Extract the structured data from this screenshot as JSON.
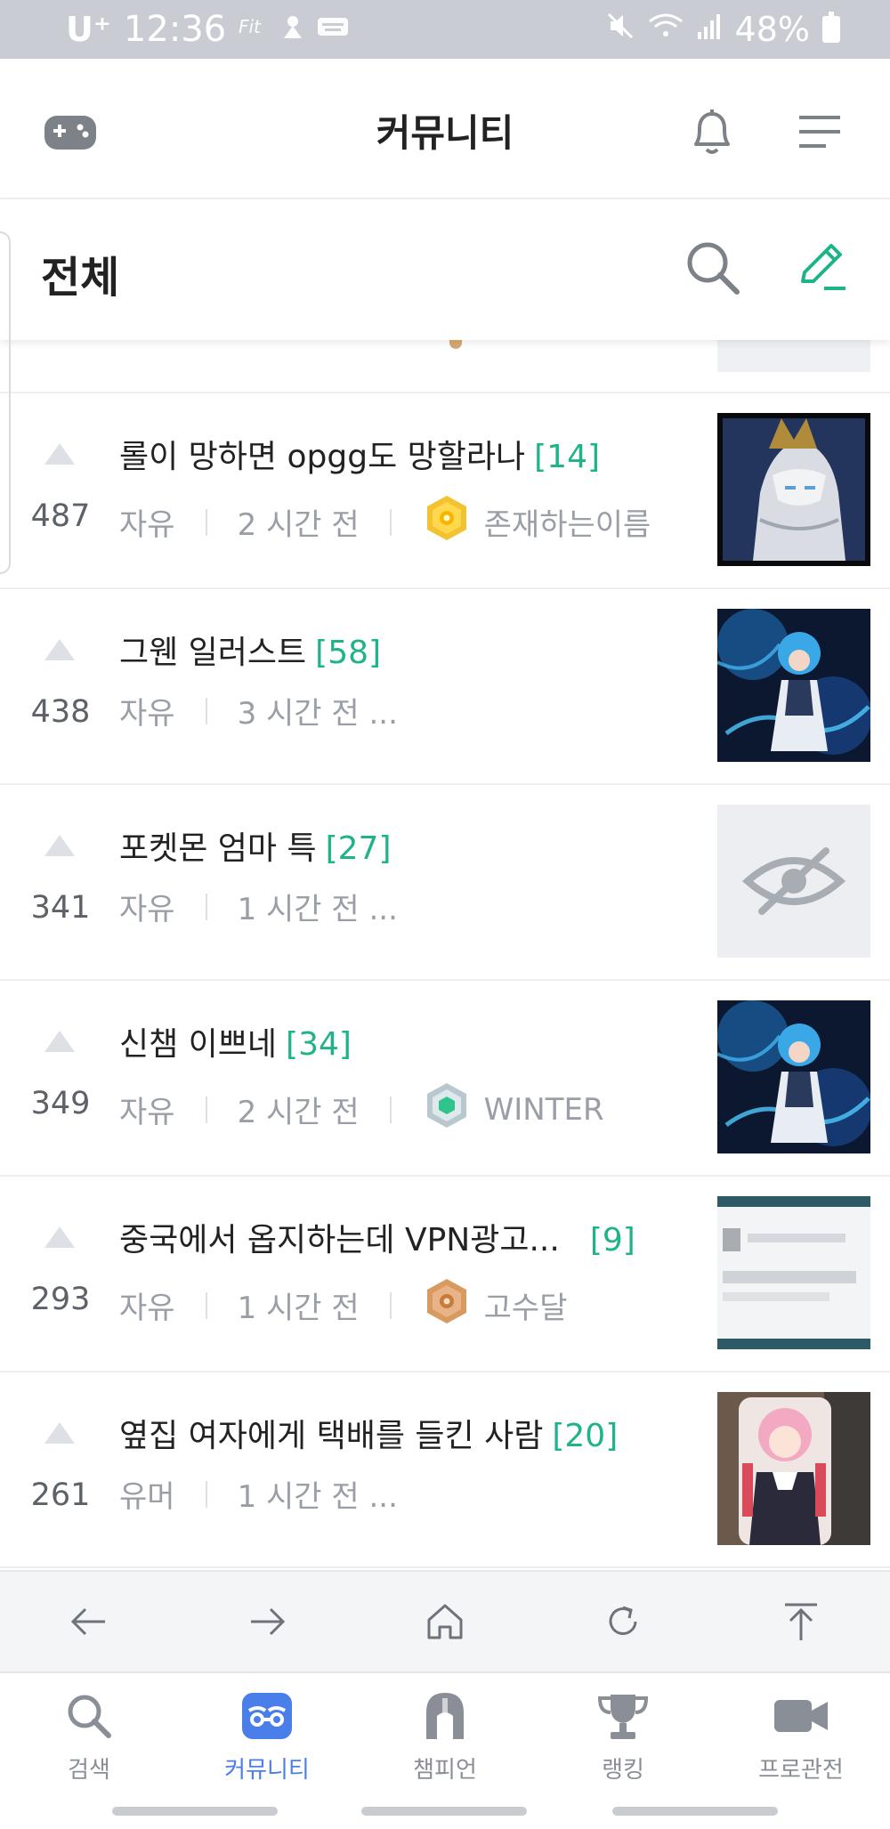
{
  "status_bar": {
    "carrier": "U⁺",
    "time": "12:36",
    "battery": "48%",
    "left_icons": [
      "fit-icon",
      "notification-icon",
      "keyboard-icon"
    ],
    "right_icons": [
      "mute-icon",
      "wifi-icon",
      "signal-icon",
      "battery-icon"
    ]
  },
  "header": {
    "title": "커뮤니티"
  },
  "section": {
    "title": "전체"
  },
  "colors": {
    "accent_green": "#1fb38a",
    "active_tab_blue": "#4a7ee8"
  },
  "posts": [
    {
      "title": "롤이 망하면 opgg도 망할라나",
      "comments": "[14]",
      "votes": "487",
      "category": "자유",
      "time": "2 시간 전",
      "author": "존재하는이름",
      "badge": "gold-hexagon-badge",
      "thumb": "armored-champion-thumbnail"
    },
    {
      "title": "그웬 일러스트",
      "comments": "[58]",
      "votes": "438",
      "category": "자유",
      "time": "3 시간 전 ...",
      "thumb": "gwen-illustration-thumbnail"
    },
    {
      "title": "포켓몬 엄마 특",
      "comments": "[27]",
      "votes": "341",
      "category": "자유",
      "time": "1 시간 전 ...",
      "thumb": "hidden-image-thumbnail"
    },
    {
      "title": "신챔 이쁘네",
      "comments": "[34]",
      "votes": "349",
      "category": "자유",
      "time": "2 시간 전",
      "author": "WINTER",
      "badge": "platinum-hexagon-badge",
      "thumb": "gwen-illustration-thumbnail"
    },
    {
      "title": "중국에서 옵지하는데 VPN광고...",
      "comments": "[9]",
      "votes": "293",
      "category": "자유",
      "time": "1 시간 전",
      "author": "고수달",
      "badge": "bronze-hexagon-badge",
      "thumb": "blurred-screenshot-thumbnail"
    },
    {
      "title": "옆집 여자에게 택배를 들킨 사람",
      "comments": "[20]",
      "votes": "261",
      "category": "유머",
      "time": "1 시간 전 ...",
      "thumb": "anime-pillow-thumbnail"
    }
  ],
  "browser_nav": [
    "back-icon",
    "forward-icon",
    "home-icon",
    "reload-icon",
    "scroll-top-icon"
  ],
  "tabs": [
    {
      "label": "검색",
      "icon": "search-icon"
    },
    {
      "label": "커뮤니티",
      "icon": "community-icon",
      "active": true
    },
    {
      "label": "챔피언",
      "icon": "helmet-icon"
    },
    {
      "label": "랭킹",
      "icon": "trophy-icon"
    },
    {
      "label": "프로관전",
      "icon": "video-icon"
    }
  ]
}
